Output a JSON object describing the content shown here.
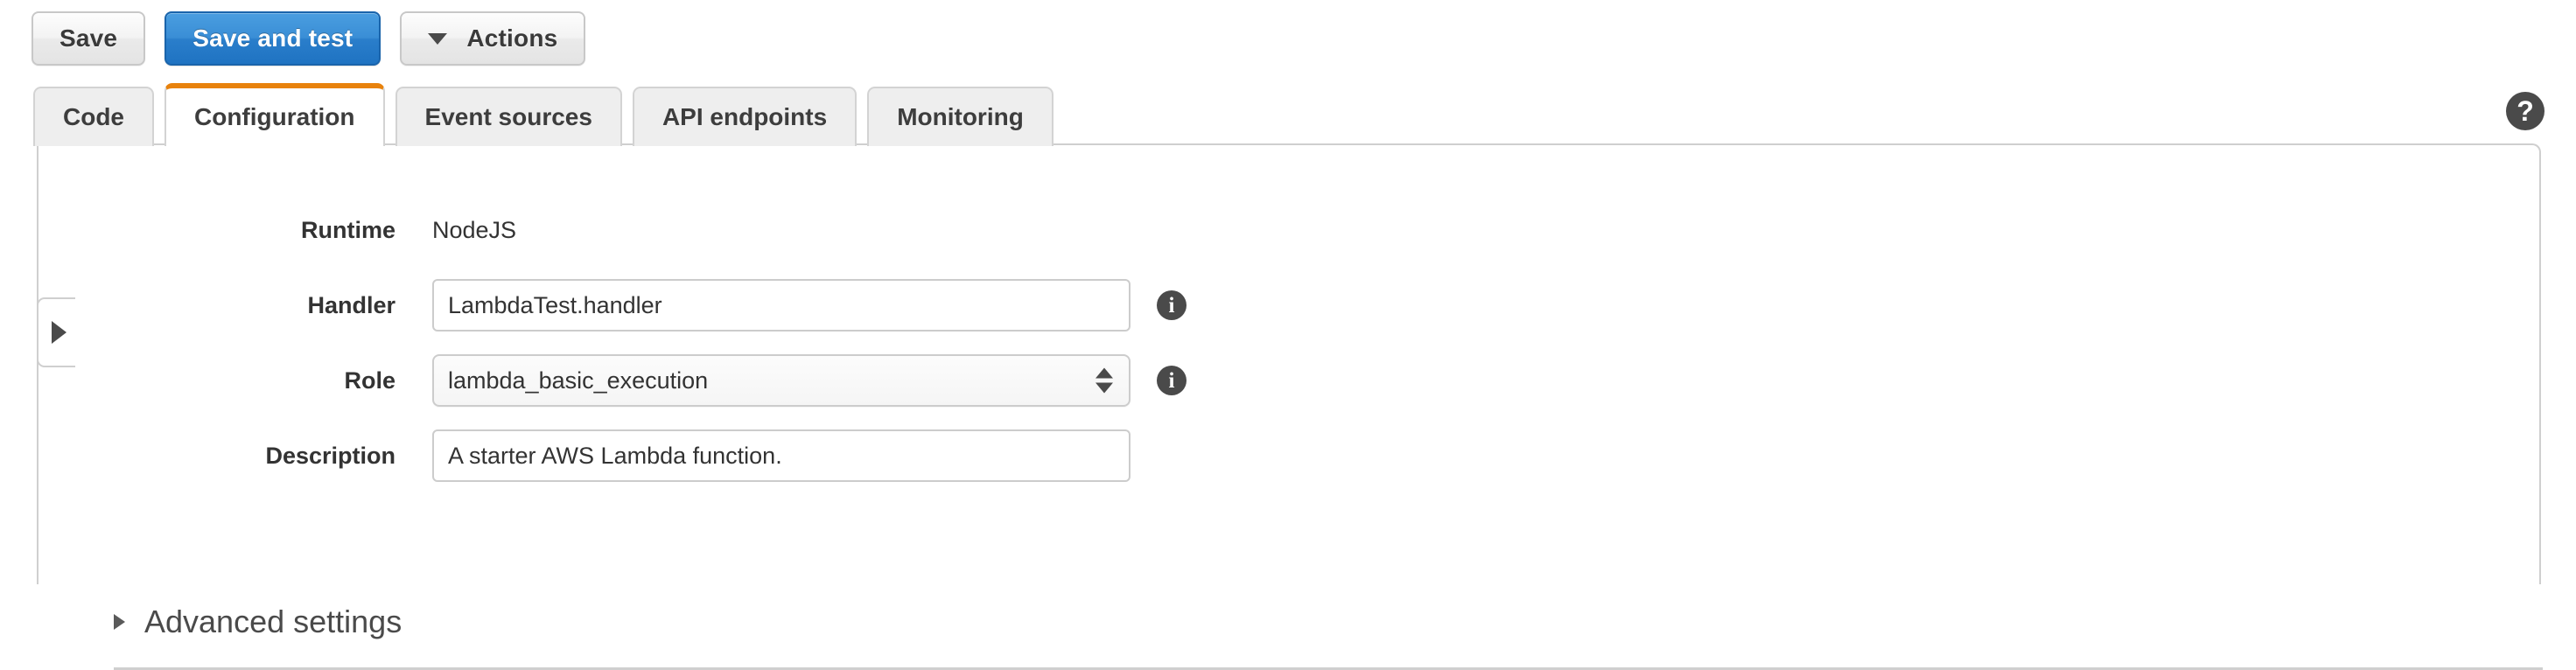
{
  "toolbar": {
    "save_label": "Save",
    "save_and_test_label": "Save and test",
    "actions_label": "Actions",
    "actions_caret_icon": "caret-down-icon",
    "primary_button_color": "#2a7ecb"
  },
  "tabs": {
    "active": "Configuration",
    "active_indicator_color": "#e8820c",
    "items": [
      {
        "label": "Code"
      },
      {
        "label": "Configuration"
      },
      {
        "label": "Event sources"
      },
      {
        "label": "API endpoints"
      },
      {
        "label": "Monitoring"
      }
    ]
  },
  "help": {
    "icon": "question-mark-icon",
    "glyph": "?"
  },
  "sidebar_handle": {
    "icon": "expand-right-icon"
  },
  "form": {
    "runtime": {
      "label": "Runtime",
      "value": "NodeJS"
    },
    "handler": {
      "label": "Handler",
      "value": "LambdaTest.handler",
      "placeholder": "",
      "info_icon": "info-icon",
      "info_glyph": "i"
    },
    "role": {
      "label": "Role",
      "value": "lambda_basic_execution",
      "options": [
        "lambda_basic_execution"
      ],
      "stepper_icon": "updown-stepper-icon",
      "info_icon": "info-icon",
      "info_glyph": "i"
    },
    "description": {
      "label": "Description",
      "value": "A starter AWS Lambda function.",
      "placeholder": ""
    }
  },
  "advanced": {
    "label": "Advanced settings",
    "disclosure_icon": "triangle-right-icon"
  }
}
